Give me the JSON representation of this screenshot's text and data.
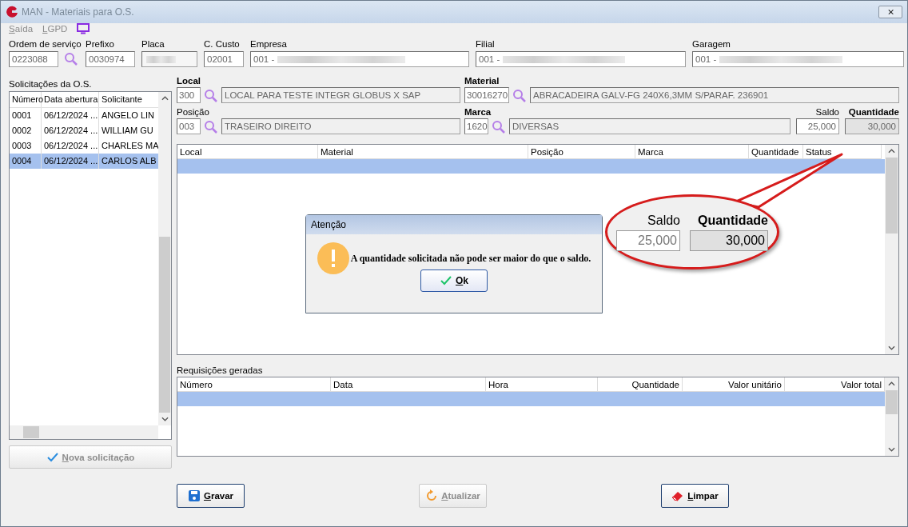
{
  "window": {
    "title": "MAN - Materiais para O.S.",
    "close": "⨯"
  },
  "menu": [
    {
      "label": "Saída",
      "disabled": true
    },
    {
      "label": "LGPD",
      "disabled": true
    }
  ],
  "header_fields": [
    {
      "label": "Ordem de serviço",
      "value": "0223088",
      "lookup": true
    },
    {
      "label": "Prefixo",
      "value": "0030974"
    },
    {
      "label": "Placa",
      "redacted": true
    },
    {
      "label": "C. Custo",
      "value": "02001"
    },
    {
      "label": "Empresa",
      "value": "001 -",
      "redacted": true
    },
    {
      "label": "Filial",
      "value": "001 -",
      "redacted": true
    },
    {
      "label": "Garagem",
      "value": "001 -",
      "redacted": true
    }
  ],
  "requests": {
    "title": "Solicitações da O.S.",
    "columns": [
      "Número",
      "Data abertura",
      "Solicitante"
    ],
    "rows": [
      {
        "cells": [
          "0001",
          "06/12/2024 ...",
          "ANGELO LIN"
        ],
        "selected": false
      },
      {
        "cells": [
          "0002",
          "06/12/2024 ...",
          "WILLIAM GU"
        ],
        "selected": false
      },
      {
        "cells": [
          "0003",
          "06/12/2024 ...",
          "CHARLES MA"
        ],
        "selected": false
      },
      {
        "cells": [
          "0004",
          "06/12/2024 ...",
          "CARLOS ALB"
        ],
        "selected": true
      }
    ]
  },
  "new_request_button": {
    "label": "Nova solicitação",
    "disabled": true
  },
  "item_form": [
    {
      "label": "Local",
      "code": "300",
      "description": "LOCAL PARA TESTE INTEGR GLOBUS X SAP",
      "emphasized": true
    },
    {
      "label": "Material",
      "code": "30016270",
      "description": "ABRACADEIRA GALV-FG 240X6,3MM S/PARAF. 236901",
      "emphasized": true
    },
    {
      "label": "Posição",
      "code": "003",
      "description": "TRASEIRO DIREITO",
      "emphasized": false
    },
    {
      "label": "Marca",
      "code": "1620",
      "description": "DIVERSAS",
      "emphasized": true
    }
  ],
  "saldo": {
    "label": "Saldo",
    "value": "25,000"
  },
  "quantidade": {
    "label": "Quantidade",
    "value": "30,000"
  },
  "items_table": {
    "columns": [
      "Local",
      "Material",
      "Posição",
      "Marca",
      "Quantidade",
      "Status"
    ]
  },
  "requisitions": {
    "title": "Requisições geradas",
    "columns": [
      "Número",
      "Data",
      "Hora",
      "Quantidade",
      "Valor unitário",
      "Valor total"
    ]
  },
  "buttons": [
    {
      "label": "Gravar",
      "kind": "save",
      "disabled": false
    },
    {
      "label": "Atualizar",
      "kind": "refresh",
      "disabled": true
    },
    {
      "label": "Limpar",
      "kind": "erase",
      "disabled": false
    }
  ],
  "dialog": {
    "title": "Atenção",
    "message": "A quantidade solicitada não pode ser maior do que o saldo.",
    "button": "Ok"
  },
  "callout": {
    "saldo_label": "Saldo",
    "saldo_value": "25,000",
    "quantidade_label": "Quantidade",
    "quantidade_value": "30,000"
  }
}
